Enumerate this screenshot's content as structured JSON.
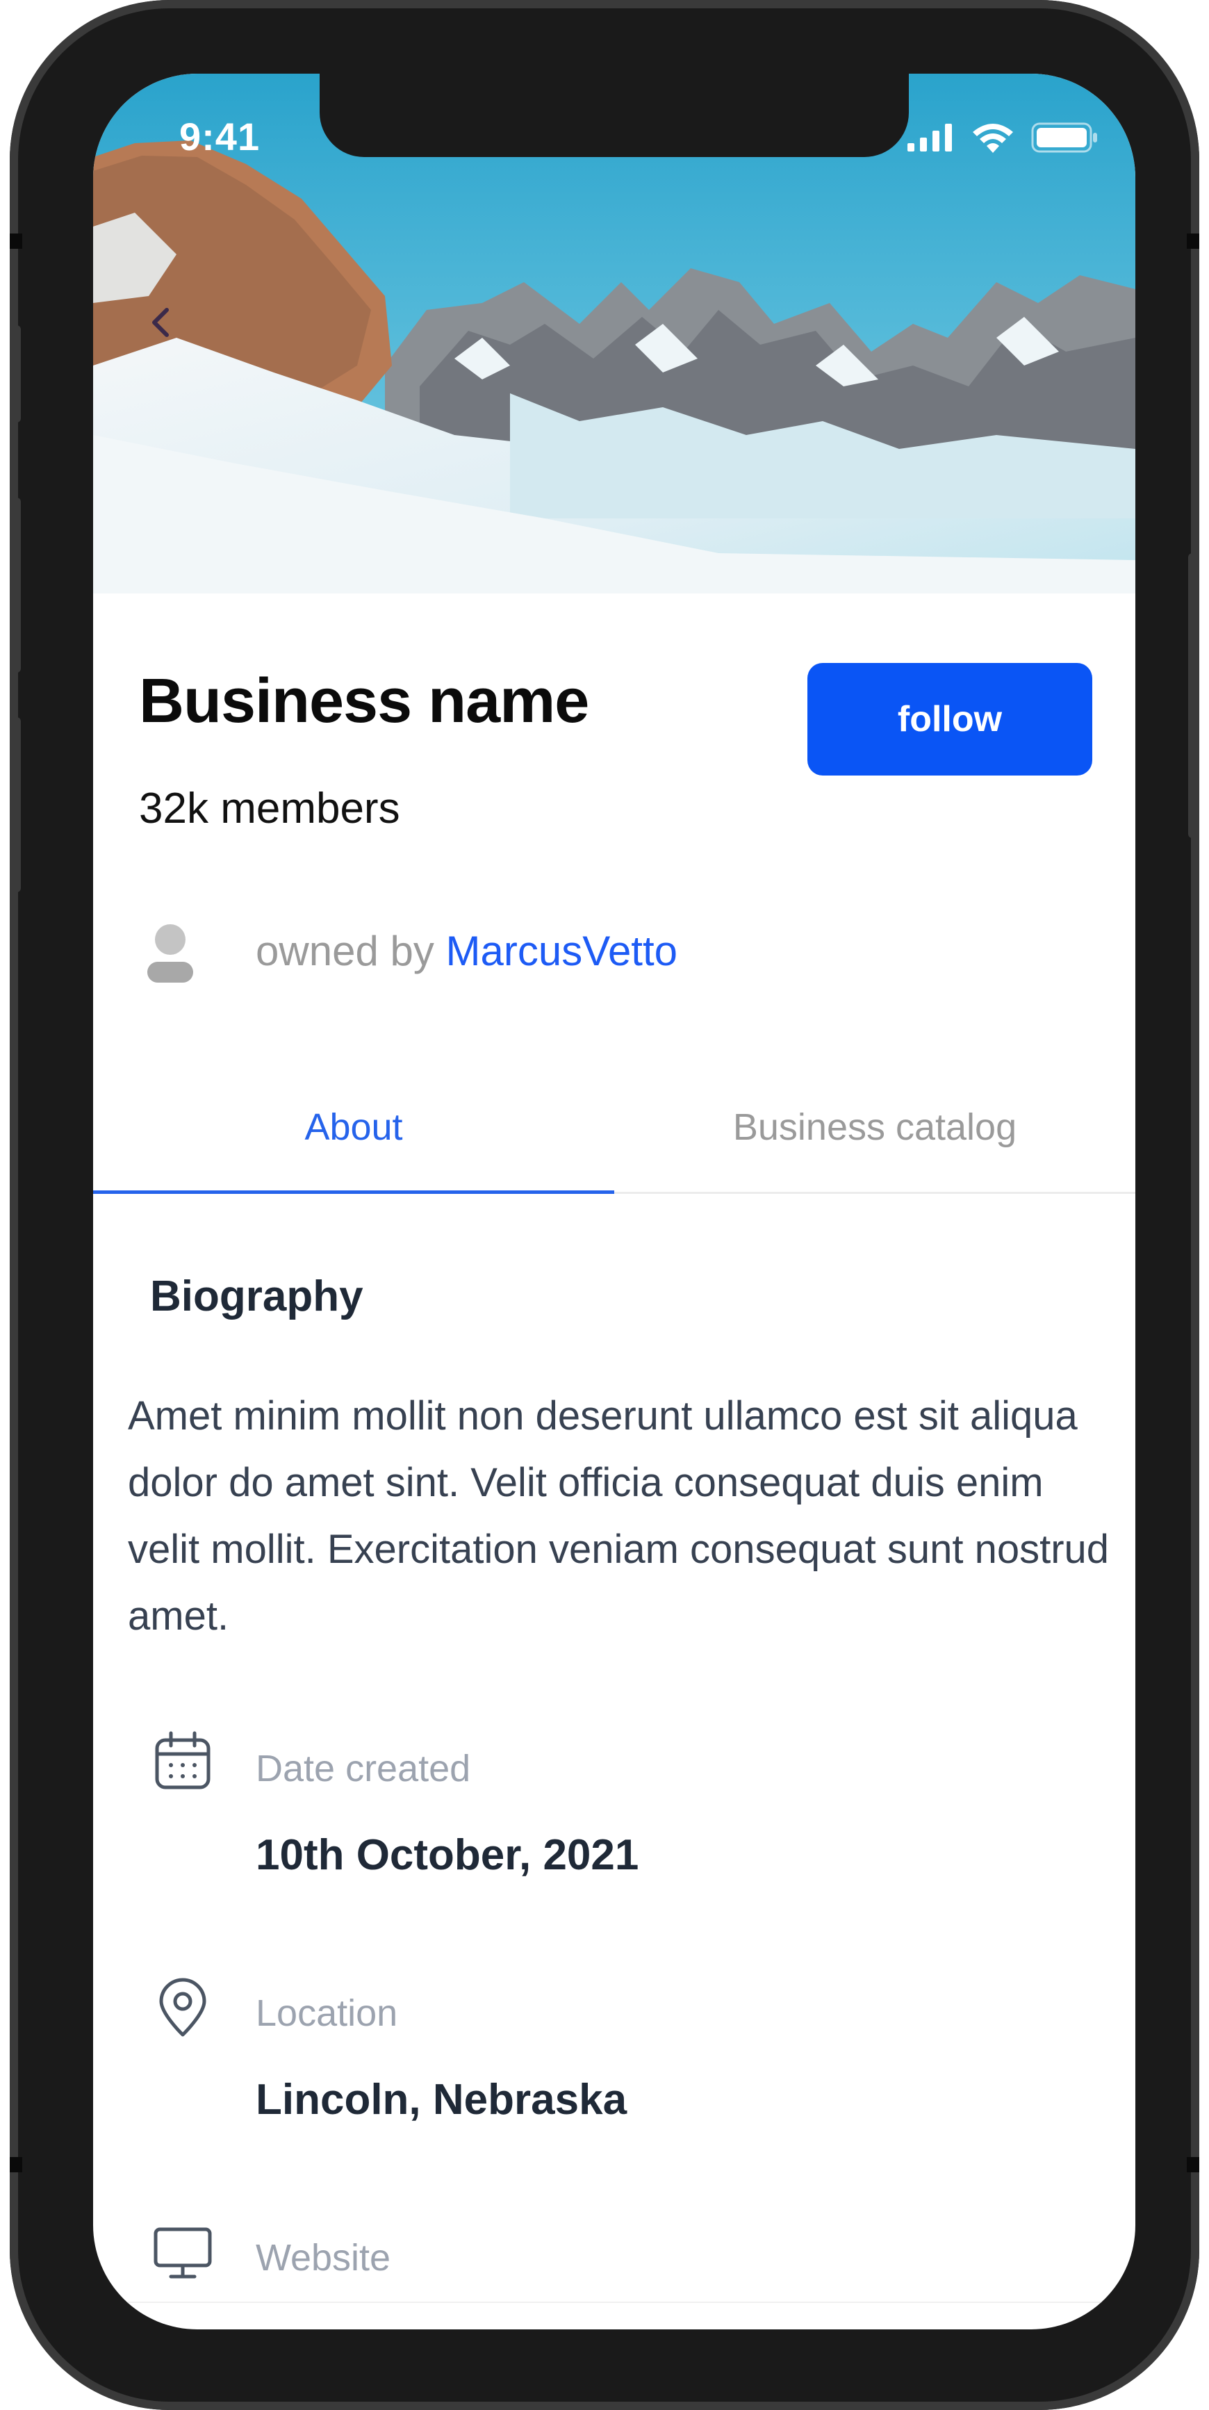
{
  "status_bar": {
    "time": "9:41",
    "icons": [
      "signal-icon",
      "wifi-icon",
      "battery-icon"
    ]
  },
  "header": {
    "back_icon": "chevron-left-icon"
  },
  "profile": {
    "business_name": "Business name",
    "members": "32k members",
    "follow_label": "follow",
    "owner_prefix": "owned by",
    "owner_name": "MarcusVetto"
  },
  "tabs": [
    {
      "label": "About",
      "active": true
    },
    {
      "label": "Business catalog",
      "active": false
    }
  ],
  "about": {
    "biography_title": "Biography",
    "biography_text": "Amet minim mollit non deserunt ullamco est sit aliqua dolor do amet sint. Velit officia consequat duis enim velit mollit. Exercitation veniam consequat sunt nostrud amet.",
    "details": [
      {
        "icon": "calendar-icon",
        "label": "Date created",
        "value": "10th October, 2021"
      },
      {
        "icon": "location-pin-icon",
        "label": "Location",
        "value": "Lincoln, Nebraska"
      },
      {
        "icon": "monitor-icon",
        "label": "Website",
        "value": ""
      }
    ]
  },
  "colors": {
    "accent": "#0a55f5",
    "link": "#1d5bf5",
    "tab_active": "#2563eb",
    "muted": "#9ca3af",
    "frame": "#1a1a1a"
  }
}
